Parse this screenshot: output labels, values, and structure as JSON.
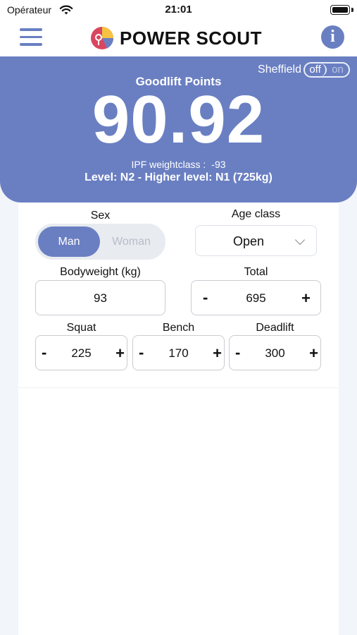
{
  "status_bar": {
    "carrier": "Opérateur",
    "time": "21:01"
  },
  "header": {
    "title": "POWER SCOUT"
  },
  "score": {
    "label": "Goodlift Points",
    "value": "90.92",
    "sheffield_label": "Sheffield",
    "toggle_off": "off",
    "toggle_on": "on",
    "weightclass_label": "IPF weightclass :",
    "weightclass_value": "-93",
    "level": "Level: N2 - Higher level: N1 (725kg)"
  },
  "form": {
    "sex_label": "Sex",
    "sex_options": [
      "Man",
      "Woman"
    ],
    "sex_selected": "Man",
    "age_label": "Age class",
    "age_value": "Open",
    "bodyweight_label": "Bodyweight (kg)",
    "bodyweight_value": "93",
    "total_label": "Total",
    "total_value": "695",
    "squat_label": "Squat",
    "squat_value": "225",
    "bench_label": "Bench",
    "bench_value": "170",
    "deadlift_label": "Deadlift",
    "deadlift_value": "300",
    "minus": "-",
    "plus": "+"
  },
  "colors": {
    "accent": "#6a7fc2",
    "background": "#f2f5f9"
  }
}
